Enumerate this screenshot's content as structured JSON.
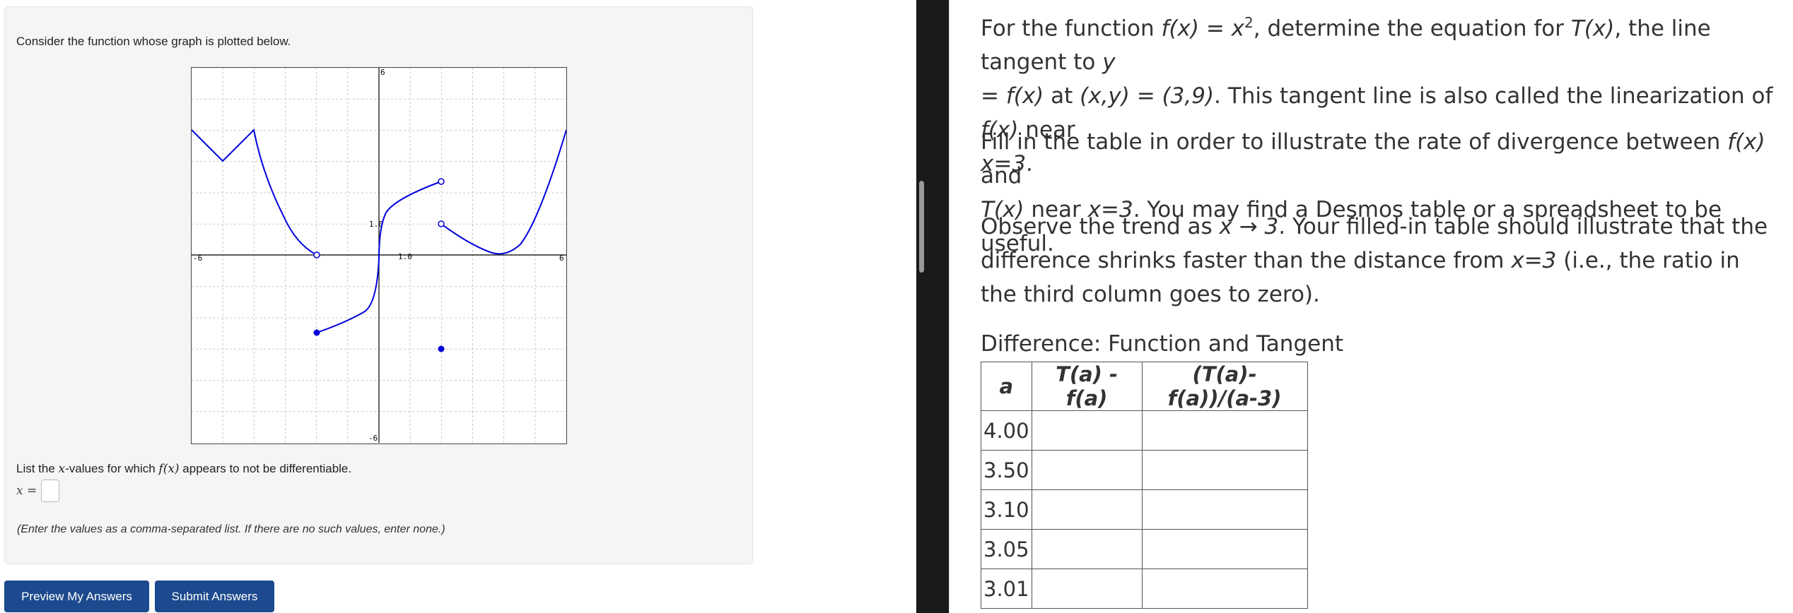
{
  "left": {
    "intro": "Consider the function whose graph is plotted below.",
    "question_prefix": "List the ",
    "question_var": "x",
    "question_mid": "-values for which ",
    "question_fn": "f(x)",
    "question_suffix": " appears to not be differentiable.",
    "answer_label": "x =",
    "answer_value": "",
    "hint": "(Enter the values as a comma-separated list. If there are no such values, enter none.)",
    "graph_ticks": {
      "x_min": "-6",
      "x_max": "6",
      "y_max": "6",
      "y_min": "-6",
      "x_unit": "1.0",
      "y_unit": "1.0"
    },
    "buttons": {
      "preview": "Preview My Answers",
      "submit": "Submit Answers"
    },
    "colors": {
      "button_bg": "#1d4a8e",
      "curve": "#0000dd"
    }
  },
  "right": {
    "para1": {
      "s1": "For the function ",
      "f_def": "f(x) = x",
      "exp": "2",
      "s2": ", determine the equation for ",
      "t": "T(x)",
      "s3": ", the line tangent to ",
      "y": "y",
      "s4": "= f(x)",
      "s5": " at ",
      "pt": "(x,y) = (3,9)",
      "s6": ". This tangent line is also called the linearization of ",
      "fx": "f(x)",
      "s7": " near ",
      "x3": "x=3",
      "s8": "."
    },
    "para2": {
      "s1": "Fill in the table in order to illustrate the rate of divergence between ",
      "fx": "f(x)",
      "s2": " and ",
      "tx": "T(x)",
      "s3": " near ",
      "x3": "x=3",
      "s4": ". You may find a Desmos table or a spreadsheet to be useful."
    },
    "para3": {
      "s1": "Observe the trend as ",
      "lim": "x → 3",
      "s2": ". Your filled-in table should illustrate that the difference shrinks faster than the distance from ",
      "x3": "x=3",
      "s3": " (i.e., the ratio in the third column goes to zero)."
    },
    "table": {
      "title": "Difference: Function and Tangent",
      "headers": [
        "a",
        "T(a) - f(a)",
        "(T(a)-f(a))/(a-3)"
      ],
      "rows": [
        {
          "a": "4.00"
        },
        {
          "a": "3.50"
        },
        {
          "a": "3.10"
        },
        {
          "a": "3.05"
        },
        {
          "a": "3.01"
        }
      ]
    }
  }
}
